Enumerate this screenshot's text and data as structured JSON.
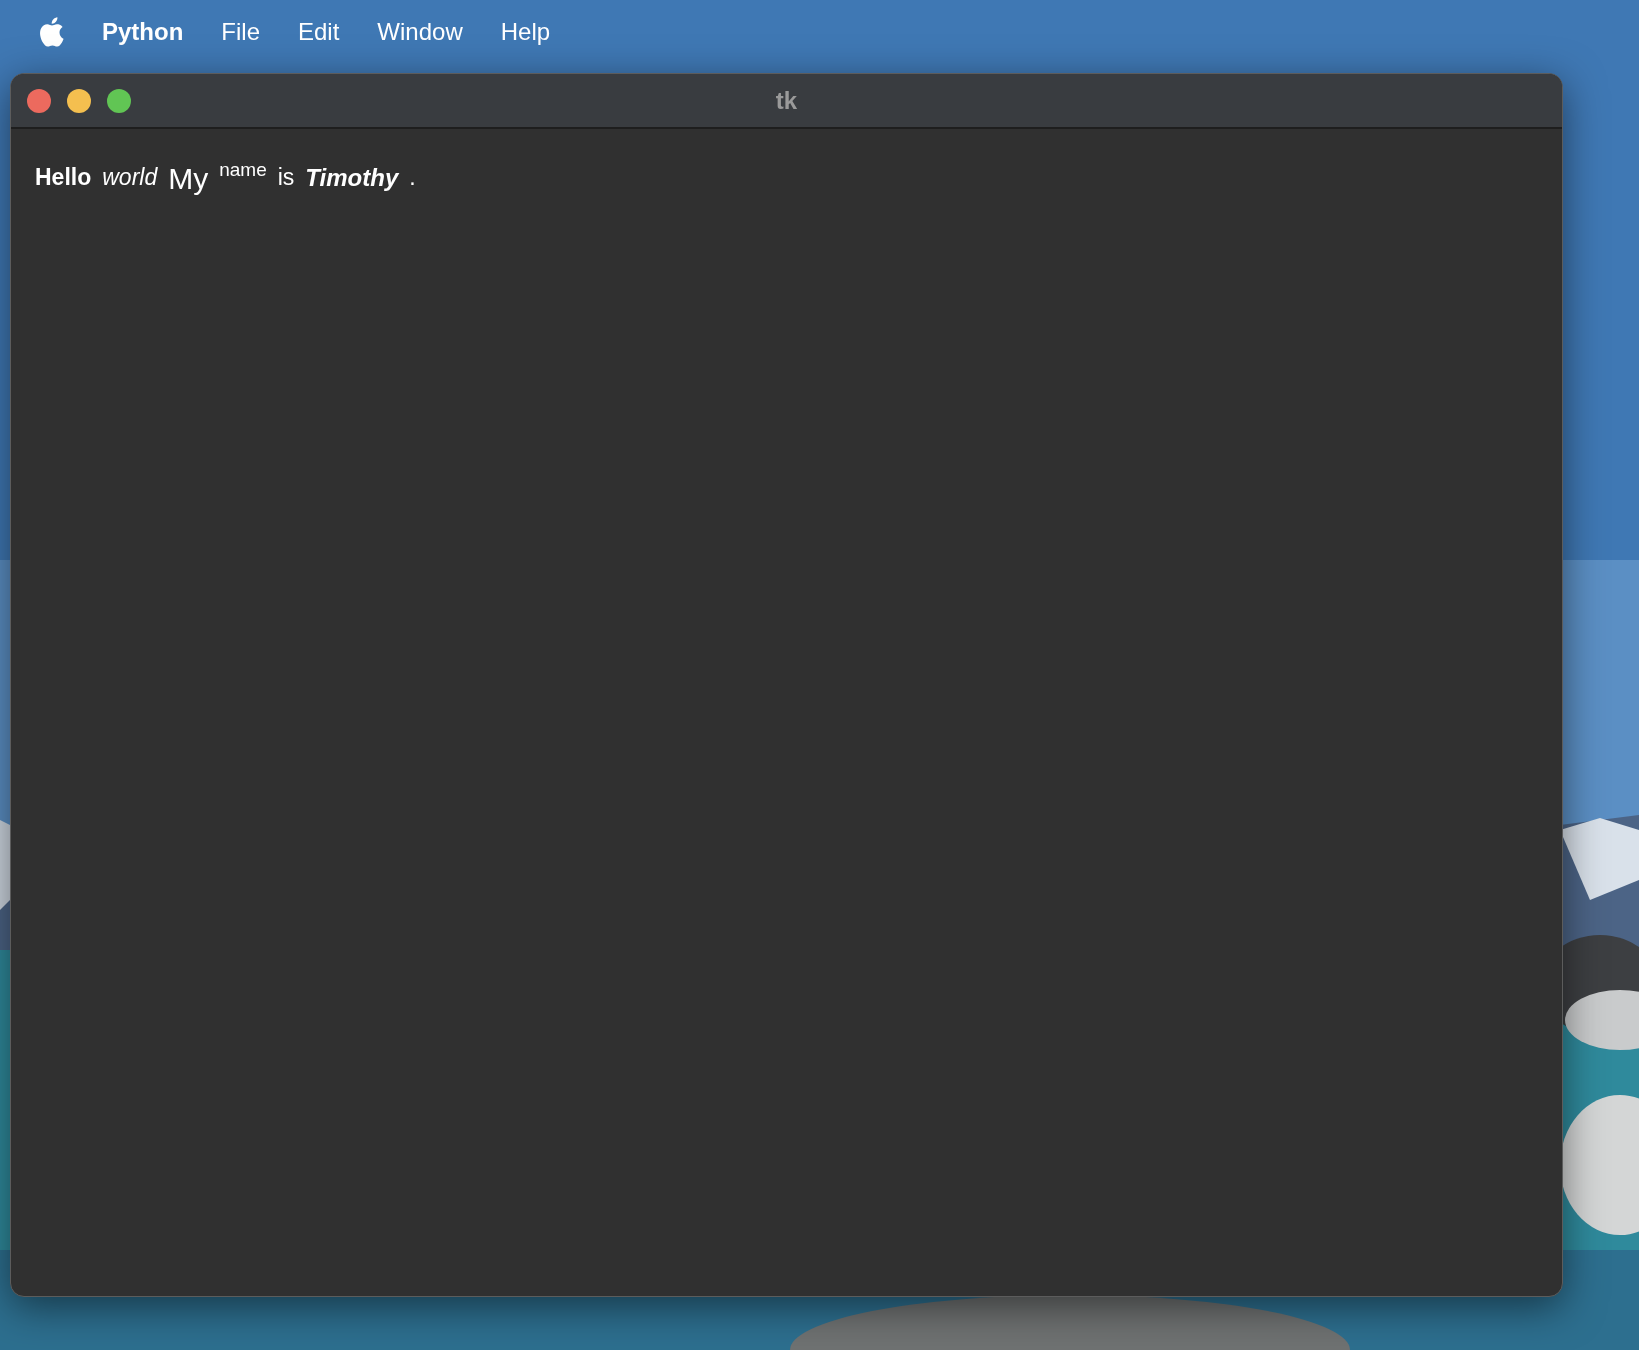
{
  "menu_bar": {
    "items": [
      {
        "label": "Python",
        "kind": "app"
      },
      {
        "label": "File",
        "kind": "menu"
      },
      {
        "label": "Edit",
        "kind": "menu"
      },
      {
        "label": "Window",
        "kind": "menu"
      },
      {
        "label": "Help",
        "kind": "menu"
      }
    ]
  },
  "window": {
    "title": "tk"
  },
  "labels": [
    {
      "text": "Hello",
      "kind": "bold"
    },
    {
      "text": "world",
      "kind": "italic"
    },
    {
      "text": "My",
      "kind": "large"
    },
    {
      "text": "name",
      "kind": "small"
    },
    {
      "text": "is",
      "kind": "normal"
    },
    {
      "text": "Timothy",
      "kind": "bolditalic"
    },
    {
      "text": ".",
      "kind": "normal"
    }
  ]
}
